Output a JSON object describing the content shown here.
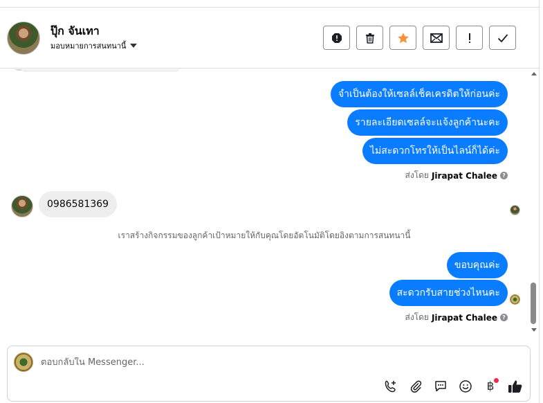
{
  "contact": {
    "name": "ปุ๊ก จันเทา",
    "assigned": "มอบหมายการสนทนานี้"
  },
  "header_buttons": [
    "spam-icon",
    "trash-icon",
    "star-icon",
    "mail-icon",
    "important-icon",
    "done-icon"
  ],
  "colors": {
    "outgoing_bubble": "#0a7cff",
    "incoming_bubble": "#eeeeee",
    "star": "#f7923a",
    "notification_dot": "#f02849"
  },
  "messages": {
    "out1": "จำเป็นต้องให้เซลล์เช็คเครดิตให้ก่อนค่ะ",
    "out2": "รายละเอียดเซลล์จะแจ้งลูกค้านะคะ",
    "out3": "ไม่สะดวกโทรให้เป็นไลน์ก็ได้ค่ะ",
    "sent_by_prefix": "ส่งโดย",
    "sent_by_name": "Jirapat Chalee",
    "in1": "0986581369",
    "system_note": "เราสร้างกิจกรรมของลูกค้าเป้าหมายให้กับคุณโดยอัตโนมัติโดยอิงตามการสนทนานี้",
    "out4": "ขอบคุณค่ะ",
    "out5": "สะดวกรับสายช่วงไหนคะ",
    "sent_by_prefix_2": "ส่งโดย",
    "sent_by_name_2": "Jirapat Chalee"
  },
  "composer": {
    "placeholder": "ตอบกลับใน Messenger...",
    "baht_symbol": "฿",
    "tools": [
      "call-add-icon",
      "attachment-icon",
      "saved-reply-icon",
      "emoji-icon",
      "payment-icon",
      "like-icon"
    ]
  }
}
